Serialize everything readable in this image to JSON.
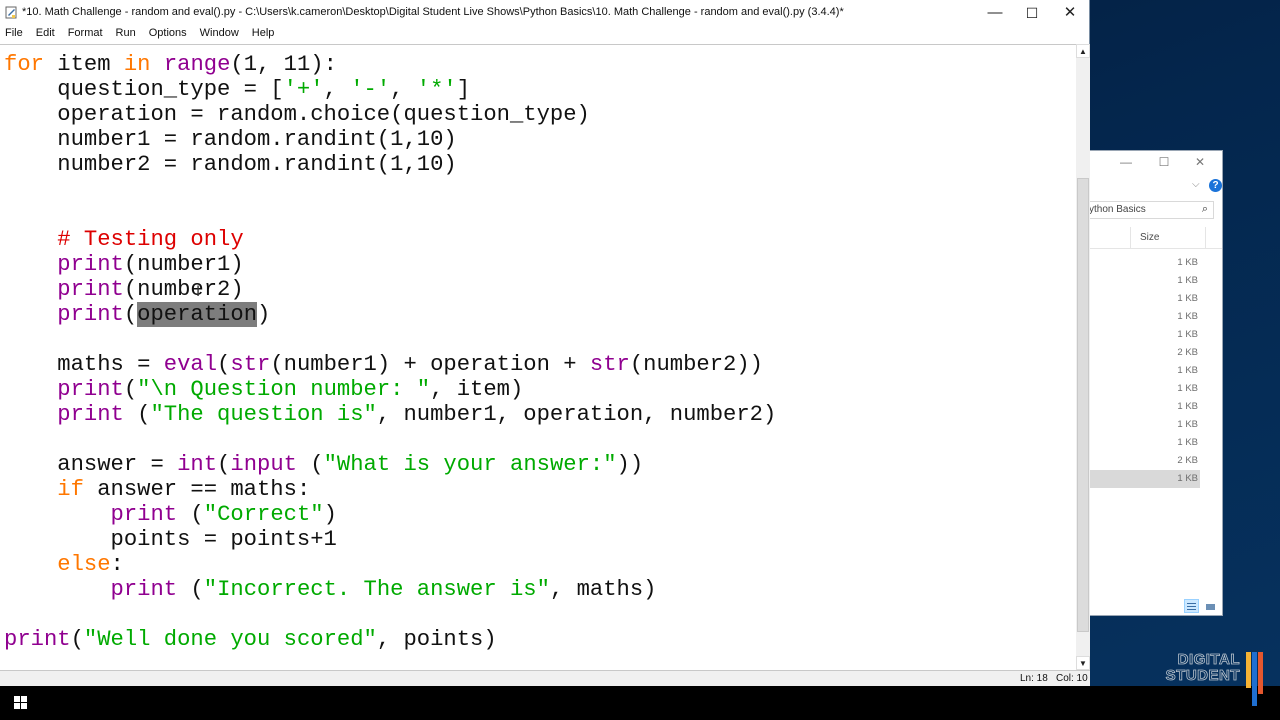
{
  "explorer": {
    "search_text": "ython Basics",
    "column_size_label": "Size",
    "sizes": [
      "1 KB",
      "1 KB",
      "1 KB",
      "1 KB",
      "1 KB",
      "2 KB",
      "1 KB",
      "1 KB",
      "1 KB",
      "1 KB",
      "1 KB",
      "2 KB",
      "1 KB"
    ],
    "selected_index": 12
  },
  "idle": {
    "title": "*10. Math Challenge - random and eval().py - C:\\Users\\k.cameron\\Desktop\\Digital Student Live Shows\\Python Basics\\10. Math Challenge - random and eval().py (3.4.4)*",
    "window_controls": {
      "minimize": "—",
      "maximize": "☐",
      "close": "✕"
    },
    "menu": [
      "File",
      "Edit",
      "Format",
      "Run",
      "Options",
      "Window",
      "Help"
    ],
    "code_lines": [
      [
        [
          "kw",
          "for"
        ],
        [
          "n",
          " item "
        ],
        [
          "kw",
          "in"
        ],
        [
          "n",
          " "
        ],
        [
          "bi",
          "range"
        ],
        [
          "n",
          "(1, 11):"
        ]
      ],
      [
        [
          "n",
          "    question_type = ["
        ],
        [
          "st",
          "'+'"
        ],
        [
          "n",
          ", "
        ],
        [
          "st",
          "'-'"
        ],
        [
          "n",
          ", "
        ],
        [
          "st",
          "'*'"
        ],
        [
          "n",
          "]"
        ]
      ],
      [
        [
          "n",
          "    operation = random.choice(question_type)"
        ]
      ],
      [
        [
          "n",
          "    number1 = random.randint(1,10)"
        ]
      ],
      [
        [
          "n",
          "    number2 = random.randint(1,10)"
        ]
      ],
      [],
      [],
      [
        [
          "n",
          "    "
        ],
        [
          "cm",
          "# Testing only"
        ]
      ],
      [
        [
          "n",
          "    "
        ],
        [
          "bi",
          "print"
        ],
        [
          "n",
          "(number1)"
        ]
      ],
      [
        [
          "n",
          "    "
        ],
        [
          "bi",
          "print"
        ],
        [
          "n",
          "(number2)"
        ]
      ],
      [
        [
          "n",
          "    "
        ],
        [
          "bi",
          "print"
        ],
        [
          "n",
          "("
        ],
        [
          "cur",
          ""
        ],
        [
          "sel",
          "operation"
        ],
        [
          "n",
          ")"
        ]
      ],
      [],
      [
        [
          "n",
          "    maths = "
        ],
        [
          "bi",
          "eval"
        ],
        [
          "n",
          "("
        ],
        [
          "bi",
          "str"
        ],
        [
          "n",
          "(number1) + operation + "
        ],
        [
          "bi",
          "str"
        ],
        [
          "n",
          "(number2))"
        ]
      ],
      [
        [
          "n",
          "    "
        ],
        [
          "bi",
          "print"
        ],
        [
          "n",
          "("
        ],
        [
          "st",
          "\"\\n Question number: \""
        ],
        [
          "n",
          ", item)"
        ]
      ],
      [
        [
          "n",
          "    "
        ],
        [
          "bi",
          "print"
        ],
        [
          "n",
          " ("
        ],
        [
          "st",
          "\"The question is\""
        ],
        [
          "n",
          ", number1, operation, number2)"
        ]
      ],
      [],
      [
        [
          "n",
          "    answer = "
        ],
        [
          "bi",
          "int"
        ],
        [
          "n",
          "("
        ],
        [
          "bi",
          "input"
        ],
        [
          "n",
          " ("
        ],
        [
          "st",
          "\"What is your answer:\""
        ],
        [
          "n",
          "))"
        ]
      ],
      [
        [
          "n",
          "    "
        ],
        [
          "kw",
          "if"
        ],
        [
          "n",
          " answer == maths:"
        ]
      ],
      [
        [
          "n",
          "        "
        ],
        [
          "bi",
          "print"
        ],
        [
          "n",
          " ("
        ],
        [
          "st",
          "\"Correct\""
        ],
        [
          "n",
          ")"
        ]
      ],
      [
        [
          "n",
          "        points = points+1"
        ]
      ],
      [
        [
          "n",
          "    "
        ],
        [
          "kw",
          "else"
        ],
        [
          "n",
          ":"
        ]
      ],
      [
        [
          "n",
          "        "
        ],
        [
          "bi",
          "print"
        ],
        [
          "n",
          " ("
        ],
        [
          "st",
          "\"Incorrect. The answer is\""
        ],
        [
          "n",
          ", maths)"
        ]
      ],
      [],
      [
        [
          "bi",
          "print"
        ],
        [
          "n",
          "("
        ],
        [
          "st",
          "\"Well done you scored\""
        ],
        [
          "n",
          ", points)"
        ]
      ]
    ],
    "scrollbar": {
      "up_arrow": "▲",
      "down_arrow": "▼"
    },
    "status": {
      "line": "Ln: 18",
      "col": "Col: 10"
    }
  },
  "branding": {
    "line1": "DIGITAL",
    "line2": "STUDENT",
    "colors": [
      "#f5b335",
      "#1f6fd1",
      "#e4572e"
    ]
  }
}
